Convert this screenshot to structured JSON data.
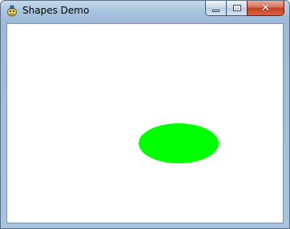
{
  "window": {
    "title": "Shapes Demo",
    "controls": {
      "minimize_icon": "minimize-icon",
      "maximize_icon": "maximize-icon",
      "close_glyph": "✕"
    }
  },
  "canvas": {
    "background": "#ffffff",
    "shapes": [
      {
        "type": "ellipse",
        "color": "#00ff00"
      }
    ]
  }
}
